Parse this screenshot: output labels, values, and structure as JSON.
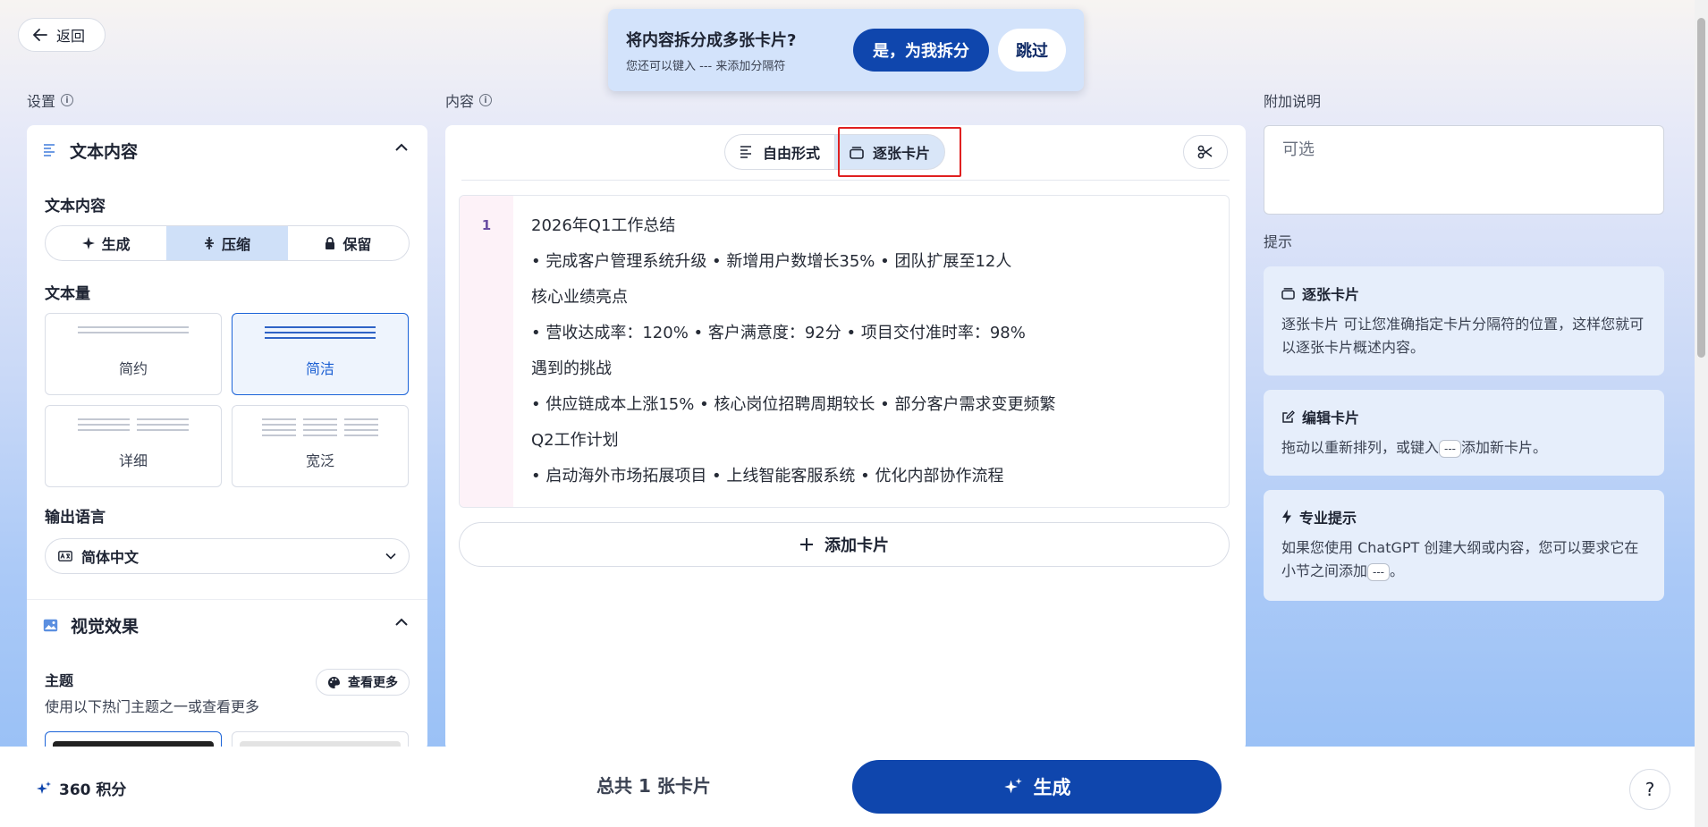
{
  "topbar": {
    "back_label": "返回"
  },
  "split_prompt": {
    "title": "将内容拆分成多张卡片?",
    "subtitle": "您还可以键入 --- 来添加分隔符",
    "confirm_label": "是，为我拆分",
    "skip_label": "跳过"
  },
  "settings": {
    "section_label": "设置",
    "text_content": {
      "header": "文本内容",
      "mode_label": "文本内容",
      "modes": [
        "生成",
        "压缩",
        "保留"
      ],
      "active_mode": "压缩",
      "amount_label": "文本量",
      "amounts": [
        "简约",
        "简洁",
        "详细",
        "宽泛"
      ],
      "selected_amount": "简洁",
      "language_label": "输出语言",
      "language_value": "简体中文"
    },
    "visual": {
      "header": "视觉效果",
      "theme_label": "主题",
      "theme_hint": "使用以下热门主题之一或查看更多",
      "more_label": "查看更多"
    }
  },
  "content": {
    "section_label": "内容",
    "tabs": [
      "自由形式",
      "逐张卡片"
    ],
    "active_tab": "逐张卡片",
    "cards": [
      {
        "number": "1",
        "lines": [
          "2026年Q1工作总结",
          "• 完成客户管理系统升级 • 新增用户数增长35% • 团队扩展至12人",
          "核心业绩亮点",
          "• 营收达成率：120% • 客户满意度：92分 • 项目交付准时率：98%",
          "遇到的挑战",
          "• 供应链成本上涨15% • 核心岗位招聘周期较长 • 部分客户需求变更频繁",
          "Q2工作计划",
          "• 启动海外市场拓展项目 • 上线智能客服系统 • 优化内部协作流程"
        ]
      }
    ],
    "add_card_label": "添加卡片"
  },
  "notes": {
    "section_label": "附加说明",
    "placeholder": "可选"
  },
  "tips": {
    "label": "提示",
    "items": [
      {
        "title": "逐张卡片",
        "body": "逐张卡片 可让您准确指定卡片分隔符的位置，这样您就可以逐张卡片概述内容。"
      },
      {
        "title": "编辑卡片",
        "body_before": "拖动以重新排列，或键入",
        "kbd": "---",
        "body_after": "添加新卡片。"
      },
      {
        "title": "专业提示",
        "body_before": "如果您使用 ChatGPT 创建大纲或内容，您可以要求它在小节之间添加",
        "kbd": "---",
        "body_after": "。"
      }
    ]
  },
  "footer": {
    "credits": "360 积分",
    "total": "总共 1 张卡片",
    "generate_label": "生成",
    "help": "?"
  },
  "colors": {
    "primary": "#0f46ad",
    "highlight": "#e02020",
    "active_segment": "#cfe0f8"
  }
}
